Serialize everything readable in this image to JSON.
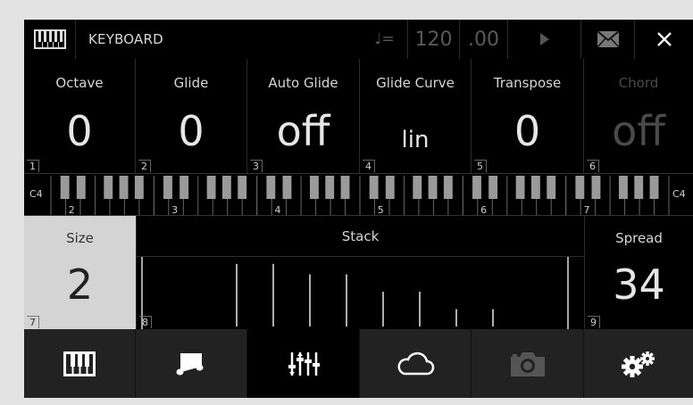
{
  "topbar": {
    "title": "KEYBOARD",
    "tempo_symbol": "♩=",
    "tempo": "120",
    "tempo_fraction": ".00",
    "icons": [
      "keyboard-icon",
      "play-icon",
      "mail-icon",
      "close-icon"
    ]
  },
  "params": [
    {
      "label": "Octave",
      "value": "0",
      "index": "1"
    },
    {
      "label": "Glide",
      "value": "0",
      "index": "2"
    },
    {
      "label": "Auto Glide",
      "value": "off",
      "index": "3"
    },
    {
      "label": "Glide Curve",
      "value": "lin",
      "index": "4"
    },
    {
      "label": "Transpose",
      "value": "0",
      "index": "5"
    },
    {
      "label": "Chord",
      "value": "off",
      "index": "6",
      "disabled": true
    }
  ],
  "keyboard": {
    "left_note": "C4",
    "right_note": "C4",
    "markers": [
      "2",
      "3",
      "4",
      "5",
      "6",
      "7"
    ]
  },
  "size": {
    "label": "Size",
    "value": "2",
    "index": "7"
  },
  "stack": {
    "label": "Stack",
    "index": "8",
    "levels": [
      0.9,
      0.9,
      0.75,
      0.75,
      0.5,
      0.5,
      0.25,
      0.25
    ]
  },
  "spread": {
    "label": "Spread",
    "value": "34",
    "index": "9"
  },
  "nav": {
    "items": [
      "keyboard-nav-icon",
      "notes-nav-icon",
      "mixer-nav-icon",
      "cloud-nav-icon",
      "camera-nav-icon",
      "settings-nav-icon"
    ],
    "active_index": 2
  },
  "colors": {
    "background": "#000000",
    "active_cell": "#d4d4d4",
    "nav": "#222222"
  }
}
